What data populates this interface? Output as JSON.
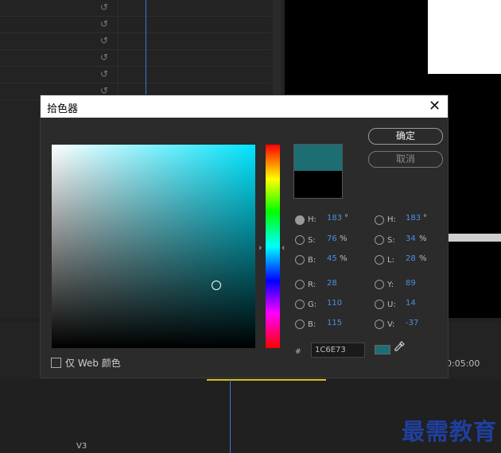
{
  "dialog": {
    "title": "拾色器",
    "close_glyph": "✕",
    "ok_label": "确定",
    "cancel_label": "取消",
    "web_only_label": "仅 Web 颜色",
    "hex_prefix": "#",
    "hex_value": "1C6E73",
    "new_color": "#1C6E73",
    "old_color": "#000000",
    "hsb": {
      "h": {
        "label": "H:",
        "value": "183",
        "unit": "°",
        "selected": true
      },
      "s": {
        "label": "S:",
        "value": "76",
        "unit": "%"
      },
      "b": {
        "label": "B:",
        "value": "45",
        "unit": "%"
      }
    },
    "rgb": {
      "r": {
        "label": "R:",
        "value": "28"
      },
      "g": {
        "label": "G:",
        "value": "110"
      },
      "b": {
        "label": "B:",
        "value": "115"
      }
    },
    "hsl": {
      "h": {
        "label": "H:",
        "value": "183",
        "unit": "°"
      },
      "s": {
        "label": "S:",
        "value": "34",
        "unit": "%"
      },
      "l": {
        "label": "L:",
        "value": "28",
        "unit": "%"
      }
    },
    "yuv": {
      "y": {
        "label": "Y:",
        "value": "89"
      },
      "u": {
        "label": "U:",
        "value": "14"
      },
      "v": {
        "label": "V:",
        "value": "-37"
      }
    },
    "hue_arrow_left": "›",
    "hue_arrow_right": "‹"
  },
  "background": {
    "reset_icon": "↺",
    "timecode": "0:05:00",
    "track_label": "V3",
    "watermark": "最需教育"
  },
  "icons": {
    "eyedropper": "eyedropper-icon",
    "close": "close-icon",
    "reset": "reset-icon"
  }
}
